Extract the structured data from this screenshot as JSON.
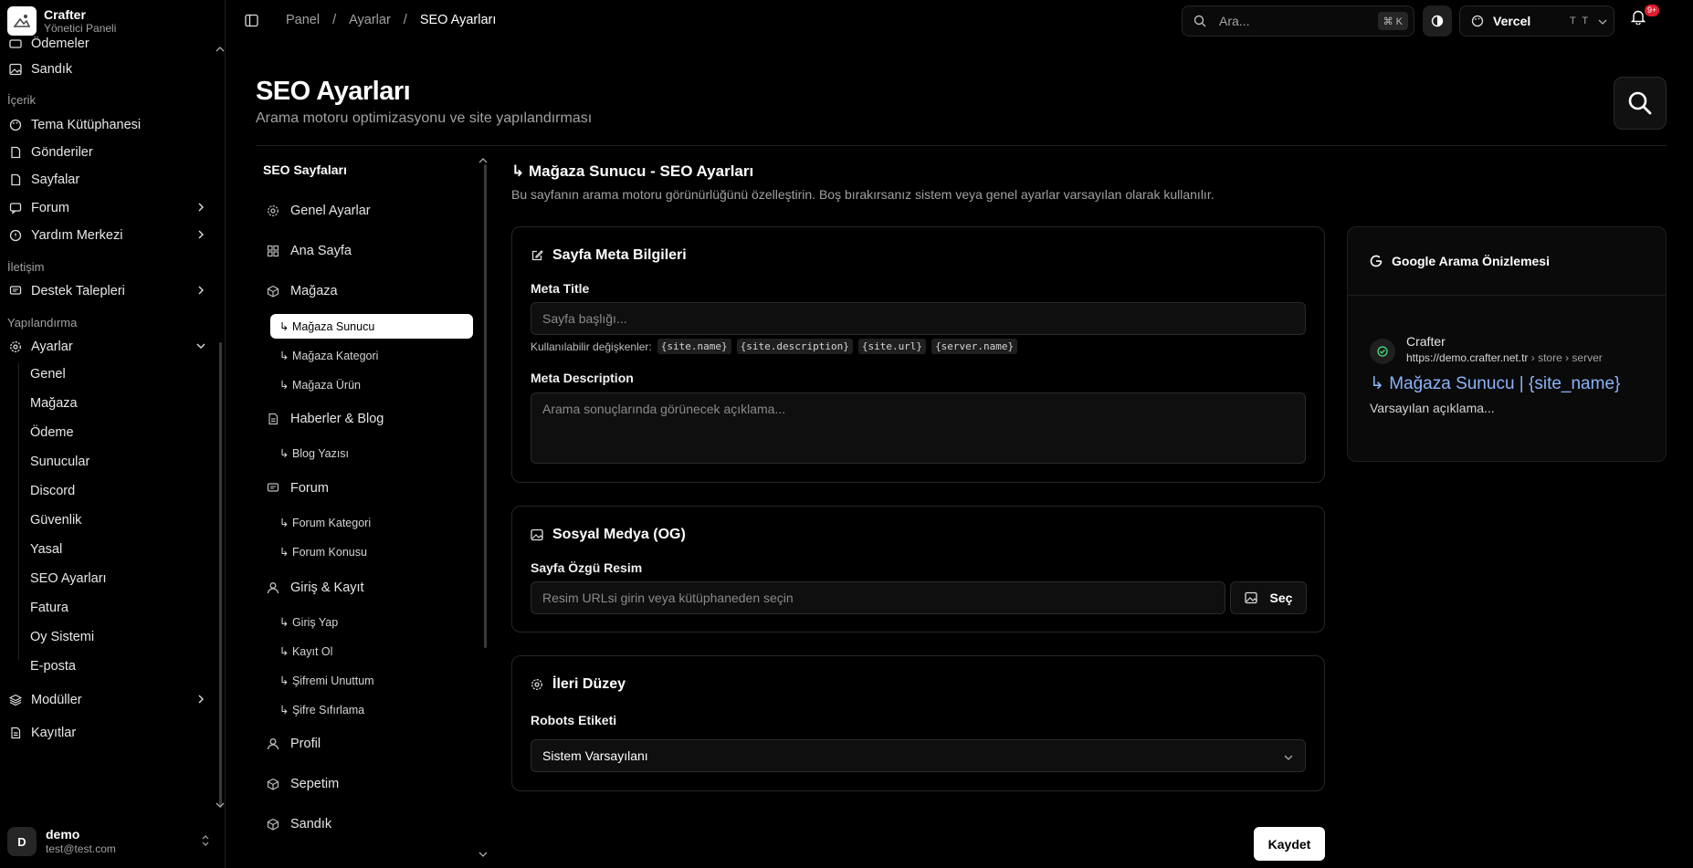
{
  "brand": {
    "name": "Crafter",
    "subtitle": "Yönetici Paneli"
  },
  "sidebar": {
    "cut_item": "Ödemeler",
    "sandik": "Sandık",
    "group_content": "İçerik",
    "theme_library": "Tema Kütüphanesi",
    "posts": "Gönderiler",
    "pages": "Sayfalar",
    "forum": "Forum",
    "help_center": "Yardım Merkezi",
    "group_contact": "İletişim",
    "support": "Destek Talepleri",
    "group_config": "Yapılandırma",
    "settings": "Ayarlar",
    "settings_sub": [
      "Genel",
      "Mağaza",
      "Ödeme",
      "Sunucular",
      "Discord",
      "Güvenlik",
      "Yasal",
      "SEO Ayarları",
      "Fatura",
      "Oy Sistemi",
      "E-posta"
    ],
    "modules": "Modüller",
    "logs": "Kayıtlar"
  },
  "user": {
    "initial": "D",
    "name": "demo",
    "email": "test@test.com"
  },
  "header": {
    "breadcrumb": [
      "Panel",
      "Ayarlar",
      "SEO Ayarları"
    ],
    "search_placeholder": "Ara...",
    "search_shortcut": "⌘ K",
    "deploy_name": "Vercel",
    "deploy_badge": "T T",
    "notification_count": "9+"
  },
  "page": {
    "title": "SEO Ayarları",
    "subtitle": "Arama motoru optimizasyonu ve site yapılandırması"
  },
  "seo_pages": {
    "title": "SEO Sayfaları",
    "general": "Genel Ayarlar",
    "home": "Ana Sayfa",
    "store": "Mağaza",
    "store_server": "↳ Mağaza Sunucu",
    "store_category": "↳ Mağaza Kategori",
    "store_product": "↳ Mağaza Ürün",
    "news": "Haberler & Blog",
    "blog_post": "↳ Blog Yazısı",
    "forum": "Forum",
    "forum_category": "↳ Forum Kategori",
    "forum_topic": "↳ Forum Konusu",
    "auth": "Giriş & Kayıt",
    "login": "↳ Giriş Yap",
    "register": "↳ Kayıt Ol",
    "forgot": "↳ Şifremi Unuttum",
    "reset": "↳ Şifre Sıfırlama",
    "profile": "Profil",
    "cart": "Sepetim",
    "chest": "Sandık"
  },
  "main": {
    "title": "↳ Mağaza Sunucu - SEO Ayarları",
    "subtitle": "Bu sayfanın arama motoru görünürlüğünü özelleştirin. Boş bırakırsanız sistem veya genel ayarlar varsayılan olarak kullanılır.",
    "meta_card_title": "Sayfa Meta Bilgileri",
    "meta_title_label": "Meta Title",
    "meta_title_placeholder": "Sayfa başlığı...",
    "vars_label": "Kullanılabilir değişkenler:",
    "vars": [
      "{site.name}",
      "{site.description}",
      "{site.url}",
      "{server.name}"
    ],
    "meta_desc_label": "Meta Description",
    "meta_desc_placeholder": "Arama sonuçlarında görünecek açıklama...",
    "og_card_title": "Sosyal Medya (OG)",
    "og_image_label": "Sayfa Özgü Resim",
    "og_image_placeholder": "Resim URLsi girin veya kütüphaneden seçin",
    "og_select_button": "Seç",
    "advanced_card_title": "İleri Düzey",
    "robots_label": "Robots Etiketi",
    "robots_value": "Sistem Varsayılanı",
    "save_button": "Kaydet"
  },
  "preview": {
    "title": "Google Arama Önizlemesi",
    "site_name": "Crafter",
    "url_host": "https://demo.crafter.net.tr",
    "url_path": " › store › server",
    "result_title": "↳ Mağaza Sunucu | {site_name}",
    "result_desc": "Varsayılan açıklama..."
  },
  "colors": {
    "accent_link": "#8ab4f8",
    "badge": "#e11d2e",
    "background": "#000000"
  }
}
